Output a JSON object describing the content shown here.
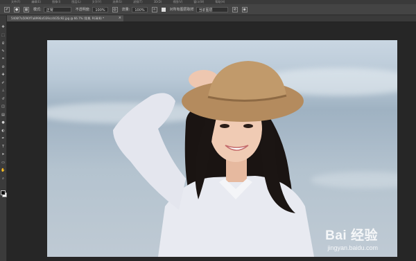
{
  "menubar": {
    "items": [
      "文件(F)",
      "编辑(E)",
      "图像(I)",
      "图层(L)",
      "文字(Y)",
      "选择(S)",
      "滤镜(T)",
      "3D(D)",
      "视图(V)",
      "窗口(W)",
      "帮助(H)"
    ]
  },
  "options": {
    "mode_label": "模式:",
    "mode_value": "正常",
    "opacity_label": "不透明度:",
    "opacity_value": "100%",
    "flow_label": "流量:",
    "flow_value": "100%",
    "checkbox_label": "对所有图层取样",
    "sample_value": "当前图层"
  },
  "document": {
    "tab_title": "5406f7a5090f7a8996af339cc4435c92.jpg @ 66.7% (背景, RGB/8) *"
  },
  "tools": [
    {
      "name": "move",
      "glyph": "✥"
    },
    {
      "name": "marquee",
      "glyph": "⬚"
    },
    {
      "name": "lasso",
      "glyph": "ϱ"
    },
    {
      "name": "quick-select",
      "glyph": "✎"
    },
    {
      "name": "crop",
      "glyph": "⌗"
    },
    {
      "name": "eyedropper",
      "glyph": "⊘"
    },
    {
      "name": "healing",
      "glyph": "✚"
    },
    {
      "name": "brush",
      "glyph": "✐"
    },
    {
      "name": "clone-stamp",
      "glyph": "⊥"
    },
    {
      "name": "history-brush",
      "glyph": "↺"
    },
    {
      "name": "eraser",
      "glyph": "◫"
    },
    {
      "name": "gradient",
      "glyph": "▤"
    },
    {
      "name": "blur",
      "glyph": "●"
    },
    {
      "name": "dodge",
      "glyph": "◐"
    },
    {
      "name": "pen",
      "glyph": "✒"
    },
    {
      "name": "type",
      "glyph": "T"
    },
    {
      "name": "path-select",
      "glyph": "➤"
    },
    {
      "name": "shape",
      "glyph": "▭"
    },
    {
      "name": "hand",
      "glyph": "✋"
    },
    {
      "name": "zoom",
      "glyph": "⌕"
    }
  ],
  "colors": {
    "foreground": "#111111",
    "background": "#ffffff"
  },
  "watermark": {
    "brand": "Bai 经验",
    "url": "jingyan.baidu.com"
  }
}
